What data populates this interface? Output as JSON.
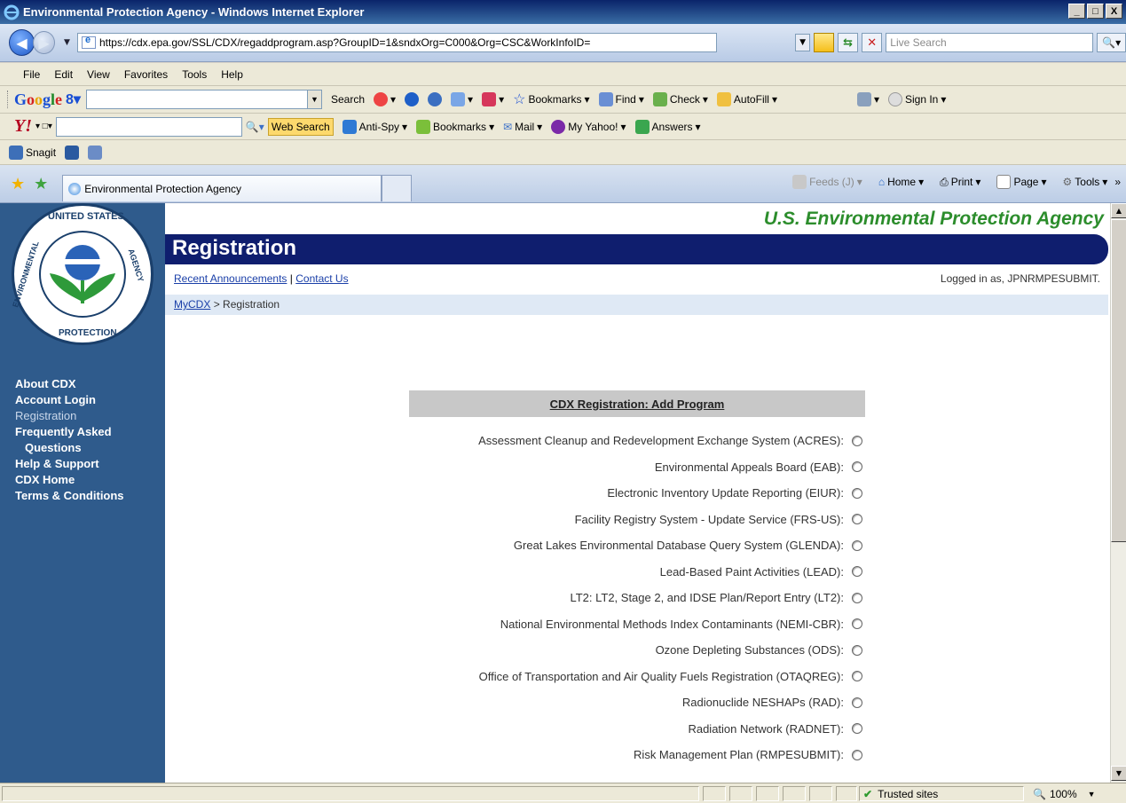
{
  "window": {
    "title": "Environmental Protection Agency - Windows Internet Explorer",
    "buttons": {
      "minimize": "_",
      "maximize": "□",
      "close": "X"
    }
  },
  "address_bar": {
    "url": "https://cdx.epa.gov/SSL/CDX/regaddprogram.asp?GroupID=1&sndxOrg=C000&Org=CSC&WorkInfoID=",
    "search_placeholder": "Live Search"
  },
  "menu": [
    "File",
    "Edit",
    "View",
    "Favorites",
    "Tools",
    "Help"
  ],
  "google_toolbar": {
    "logo": "Google",
    "search_label": "Search",
    "bookmarks_label": "Bookmarks",
    "find_label": "Find",
    "check_label": "Check",
    "autofill_label": "AutoFill",
    "signin_label": "Sign In"
  },
  "yahoo_toolbar": {
    "logo": "Y!",
    "web_search_label": "Web Search",
    "antispy_label": "Anti-Spy",
    "bookmarks_label": "Bookmarks",
    "mail_label": "Mail",
    "myyahoo_label": "My Yahoo!",
    "answers_label": "Answers"
  },
  "snagit_toolbar": {
    "label": "Snagit"
  },
  "tab": {
    "title": "Environmental Protection Agency"
  },
  "command_bar": {
    "feeds_label": "Feeds (J)",
    "home_label": "Home",
    "print_label": "Print",
    "page_label": "Page",
    "tools_label": "Tools"
  },
  "seal": {
    "top": "UNITED STATES",
    "left": "ENVIRONMENTAL",
    "right": "AGENCY",
    "bottom": "PROTECTION"
  },
  "sidebar_nav": [
    {
      "label": "About CDX"
    },
    {
      "label": "Account Login"
    },
    {
      "label": "Registration"
    },
    {
      "label": "Frequently Asked"
    },
    {
      "label": "Questions"
    },
    {
      "label": "Help & Support"
    },
    {
      "label": "CDX Home"
    },
    {
      "label": "Terms & Conditions"
    }
  ],
  "header": {
    "agency": "U.S. Environmental Protection Agency",
    "page_title": "Registration",
    "recent_announcements": "Recent Announcements",
    "separator": "|",
    "contact_us": "Contact Us",
    "logged_in": "Logged in as, JPNRMPESUBMIT."
  },
  "breadcrumb": {
    "root": "MyCDX",
    "sep": ">",
    "current": "Registration"
  },
  "programs": {
    "heading": "CDX Registration: Add Program",
    "items": [
      {
        "label": "Assessment Cleanup and Redevelopment Exchange System (ACRES):"
      },
      {
        "label": "Environmental Appeals Board (EAB):"
      },
      {
        "label": "Electronic Inventory Update Reporting (EIUR):"
      },
      {
        "label": "Facility Registry System - Update Service (FRS-US):"
      },
      {
        "label": "Great Lakes Environmental Database Query System (GLENDA):"
      },
      {
        "label": "Lead-Based Paint Activities (LEAD):"
      },
      {
        "label": "LT2: LT2, Stage 2, and IDSE Plan/Report Entry (LT2):"
      },
      {
        "label": "National Environmental Methods Index Contaminants (NEMI-CBR):"
      },
      {
        "label": "Ozone Depleting Substances (ODS):"
      },
      {
        "label": "Office of Transportation and Air Quality Fuels Registration (OTAQREG):"
      },
      {
        "label": "Radionuclide NESHAPs (RAD):"
      },
      {
        "label": "Radiation Network (RADNET):"
      },
      {
        "label": "Risk Management Plan (RMPESUBMIT):"
      }
    ]
  },
  "status_bar": {
    "zone": "Trusted sites",
    "zoom": "100%"
  }
}
